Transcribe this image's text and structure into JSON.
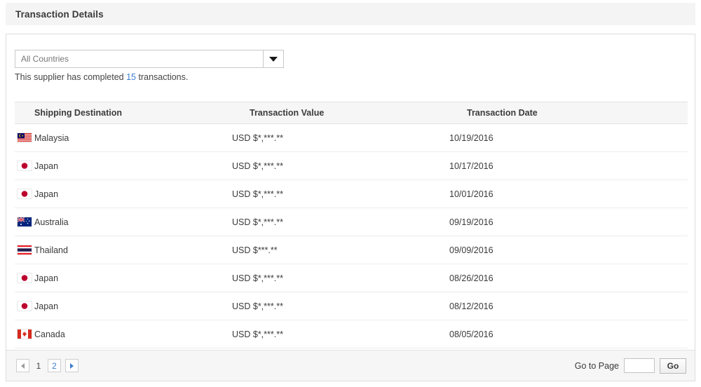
{
  "panel": {
    "title": "Transaction Details"
  },
  "filter": {
    "country_select": {
      "selected_label": "All Countries",
      "icon": "chevron-down-icon"
    },
    "summary": {
      "prefix": "This supplier has completed ",
      "count": "15",
      "suffix": " transactions."
    }
  },
  "table": {
    "columns": [
      "Shipping Destination",
      "Transaction Value",
      "Transaction Date"
    ],
    "rows": [
      {
        "destination": "Malaysia",
        "flag": "flag-malaysia",
        "value": "USD $*,***.**",
        "date": "10/19/2016"
      },
      {
        "destination": "Japan",
        "flag": "flag-japan",
        "value": "USD $*,***.**",
        "date": "10/17/2016"
      },
      {
        "destination": "Japan",
        "flag": "flag-japan",
        "value": "USD $*,***.**",
        "date": "10/01/2016"
      },
      {
        "destination": "Australia",
        "flag": "flag-australia",
        "value": "USD $*,***.**",
        "date": "09/19/2016"
      },
      {
        "destination": "Thailand",
        "flag": "flag-thailand",
        "value": "USD $***.**",
        "date": "09/09/2016"
      },
      {
        "destination": "Japan",
        "flag": "flag-japan",
        "value": "USD $*,***.**",
        "date": "08/26/2016"
      },
      {
        "destination": "Japan",
        "flag": "flag-japan",
        "value": "USD $*,***.**",
        "date": "08/12/2016"
      },
      {
        "destination": "Canada",
        "flag": "flag-canada",
        "value": "USD $*,***.**",
        "date": "08/05/2016"
      }
    ]
  },
  "footer": {
    "pagination": {
      "prev_icon": "triangle-left-icon",
      "next_icon": "triangle-right-icon",
      "current_page": "1",
      "next_page": "2"
    },
    "goto": {
      "label": "Go to Page",
      "input_value": "",
      "button_label": "Go"
    }
  },
  "colors": {
    "link": "#3f7fd0",
    "title_bar": "#f4f4f4",
    "table_header": "#f6f6f6",
    "border": "#dddddd"
  }
}
